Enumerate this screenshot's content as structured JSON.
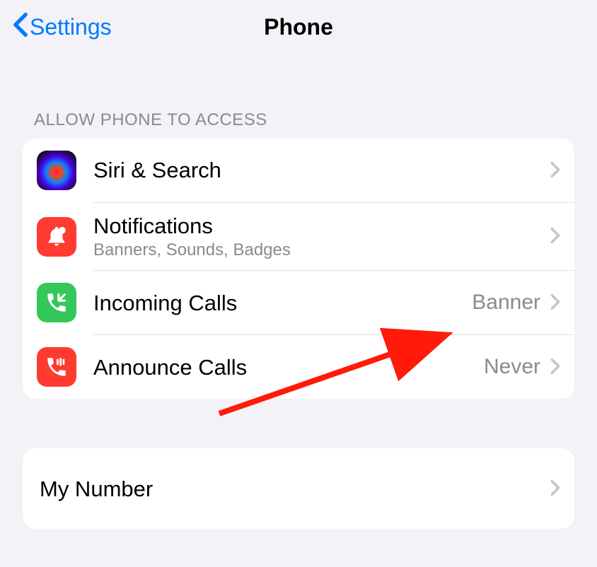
{
  "header": {
    "back_label": "Settings",
    "title": "Phone"
  },
  "sections": {
    "access": {
      "header": "Allow Phone to access",
      "rows": {
        "siri": {
          "label": "Siri & Search"
        },
        "notifications": {
          "label": "Notifications",
          "subtitle": "Banners, Sounds, Badges"
        },
        "incoming_calls": {
          "label": "Incoming Calls",
          "value": "Banner"
        },
        "announce_calls": {
          "label": "Announce Calls",
          "value": "Never"
        }
      }
    },
    "number": {
      "my_number": {
        "label": "My Number"
      }
    }
  },
  "annotation": {
    "color": "#ff1a0a",
    "target": "incoming-calls-value"
  }
}
